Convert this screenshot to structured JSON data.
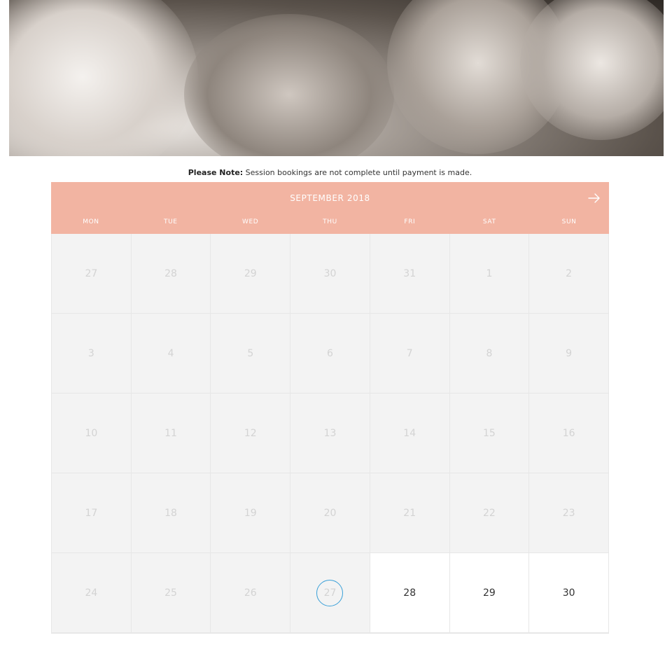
{
  "note": {
    "bold": "Please Note:",
    "text": " Session bookings are not complete until payment is made."
  },
  "calendar": {
    "month_title": "SEPTEMBER 2018",
    "next_icon": "arrow-right-icon",
    "weekdays": [
      "MON",
      "TUE",
      "WED",
      "THU",
      "FRI",
      "SAT",
      "SUN"
    ],
    "weeks": [
      [
        {
          "d": "27",
          "available": false
        },
        {
          "d": "28",
          "available": false
        },
        {
          "d": "29",
          "available": false
        },
        {
          "d": "30",
          "available": false
        },
        {
          "d": "31",
          "available": false
        },
        {
          "d": "1",
          "available": false
        },
        {
          "d": "2",
          "available": false
        }
      ],
      [
        {
          "d": "3",
          "available": false
        },
        {
          "d": "4",
          "available": false
        },
        {
          "d": "5",
          "available": false
        },
        {
          "d": "6",
          "available": false
        },
        {
          "d": "7",
          "available": false
        },
        {
          "d": "8",
          "available": false
        },
        {
          "d": "9",
          "available": false
        }
      ],
      [
        {
          "d": "10",
          "available": false
        },
        {
          "d": "11",
          "available": false
        },
        {
          "d": "12",
          "available": false
        },
        {
          "d": "13",
          "available": false
        },
        {
          "d": "14",
          "available": false
        },
        {
          "d": "15",
          "available": false
        },
        {
          "d": "16",
          "available": false
        }
      ],
      [
        {
          "d": "17",
          "available": false
        },
        {
          "d": "18",
          "available": false
        },
        {
          "d": "19",
          "available": false
        },
        {
          "d": "20",
          "available": false
        },
        {
          "d": "21",
          "available": false
        },
        {
          "d": "22",
          "available": false
        },
        {
          "d": "23",
          "available": false
        }
      ],
      [
        {
          "d": "24",
          "available": false
        },
        {
          "d": "25",
          "available": false
        },
        {
          "d": "26",
          "available": false
        },
        {
          "d": "27",
          "available": false,
          "today": true
        },
        {
          "d": "28",
          "available": true
        },
        {
          "d": "29",
          "available": true
        },
        {
          "d": "30",
          "available": true
        }
      ]
    ],
    "colors": {
      "header": "#f2b4a2",
      "today_ring": "#3aa0d8",
      "unavailable_bg": "#f3f3f3",
      "available_bg": "#ffffff"
    }
  }
}
